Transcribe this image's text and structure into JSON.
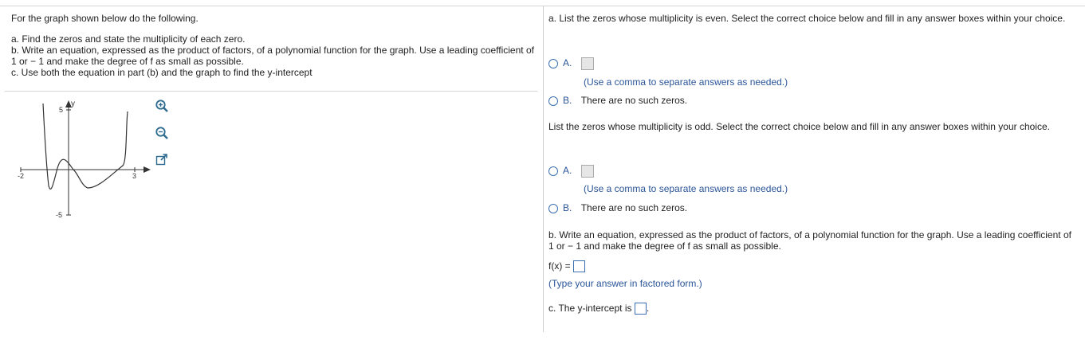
{
  "left": {
    "intro": "For the graph shown below do the following.",
    "part_a": "a. Find the zeros and state the multiplicity of each zero.",
    "part_b": "b. Write an equation, expressed as the product of factors, of a polynomial function for the graph. Use a leading coefficient of 1 or − 1 and make the degree of f as small as possible.",
    "part_c": "c. Use both the equation in part (b) and the graph to find the y-intercept"
  },
  "graph": {
    "y_axis_label": "y",
    "tick_x_neg": "-2",
    "tick_x_pos": "3",
    "tick_y_pos": "5",
    "tick_y_neg": "-5",
    "tools": [
      "zoom-in-icon",
      "zoom-out-icon",
      "external-link-icon"
    ]
  },
  "right": {
    "q_even": "a. List the zeros whose multiplicity is even. Select the correct choice below and fill in any answer boxes within your choice.",
    "even_a_letter": "A.",
    "even_a_hint": "(Use a comma to separate answers as needed.)",
    "even_b_letter": "B.",
    "even_b_text": "There are no such zeros.",
    "q_odd": "List the zeros whose multiplicity is odd. Select the correct choice below and fill in any answer boxes within your choice.",
    "odd_a_letter": "A.",
    "odd_a_hint": "(Use a comma to separate answers as needed.)",
    "odd_b_letter": "B.",
    "odd_b_text": "There are no such zeros.",
    "q_b": "b. Write an equation, expressed as the product of factors, of a polynomial function for the graph. Use a leading coefficient of 1 or − 1 and make the degree of f as small as possible.",
    "fx_label": "f(x) =",
    "fx_hint": "(Type your answer in factored form.)",
    "c_label": "c. The y-intercept is",
    "c_period": "."
  }
}
